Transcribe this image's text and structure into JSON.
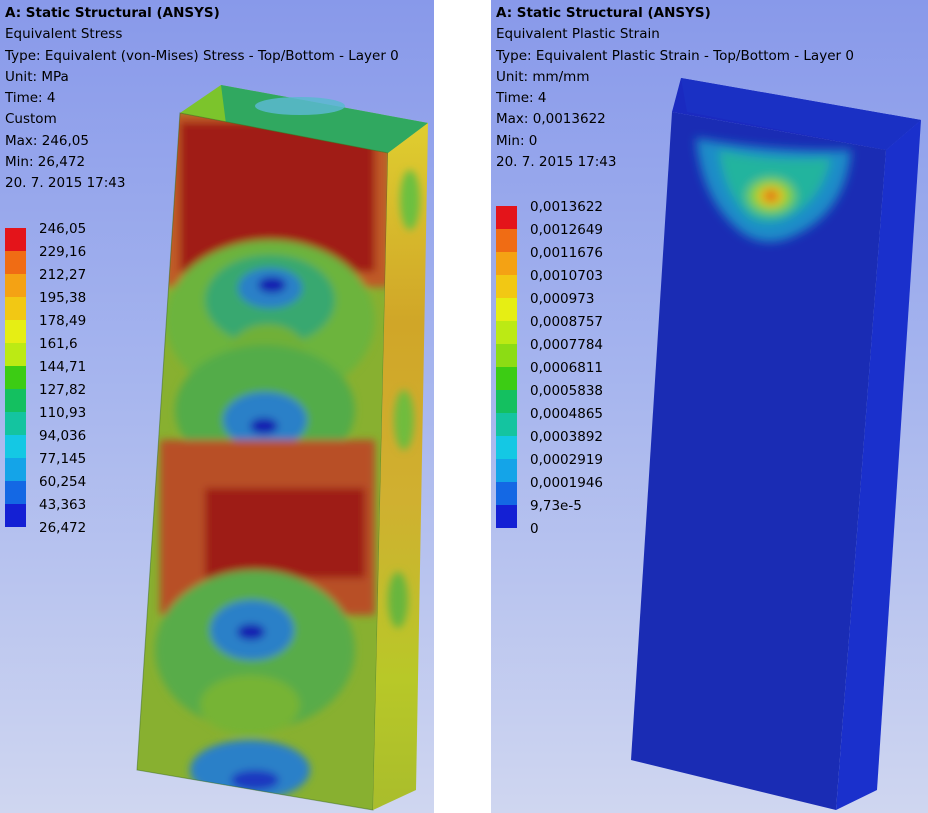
{
  "colors": {
    "scale": [
      "#e4141a",
      "#f06c14",
      "#f4a214",
      "#f2c814",
      "#e6ee14",
      "#bcea14",
      "#8cdc14",
      "#3ccc14",
      "#14c060",
      "#14c4a0",
      "#14c8e4",
      "#14a4e8",
      "#1468e4",
      "#1420d4"
    ],
    "model_dark_blue": "#1a2cb4",
    "background_top": "#8899ea",
    "background_bottom": "#cfd6f0"
  },
  "left_panel": {
    "title": "A: Static Structural (ANSYS)",
    "result_name": "Equivalent Stress",
    "type": "Type: Equivalent (von-Mises) Stress - Top/Bottom - Layer 0",
    "unit": "Unit: MPa",
    "time": "Time: 4",
    "mode": "Custom",
    "max": "Max: 246,05",
    "min": "Min: 26,472",
    "date": "20. 7. 2015 17:43",
    "legend": [
      "246,05",
      "229,16",
      "212,27",
      "195,38",
      "178,49",
      "161,6",
      "144,71",
      "127,82",
      "110,93",
      "94,036",
      "77,145",
      "60,254",
      "43,363",
      "26,472"
    ]
  },
  "right_panel": {
    "title": "A: Static Structural (ANSYS)",
    "result_name": "Equivalent Plastic Strain",
    "type": "Type: Equivalent Plastic Strain - Top/Bottom - Layer 0",
    "unit": "Unit: mm/mm",
    "time": "Time: 4",
    "max": "Max: 0,0013622",
    "min": "Min: 0",
    "date": "20. 7. 2015 17:43",
    "legend": [
      "0,0013622",
      "0,0012649",
      "0,0011676",
      "0,0010703",
      "0,000973",
      "0,0008757",
      "0,0007784",
      "0,0006811",
      "0,0005838",
      "0,0004865",
      "0,0003892",
      "0,0002919",
      "0,0001946",
      "9,73e-5",
      "0"
    ]
  }
}
